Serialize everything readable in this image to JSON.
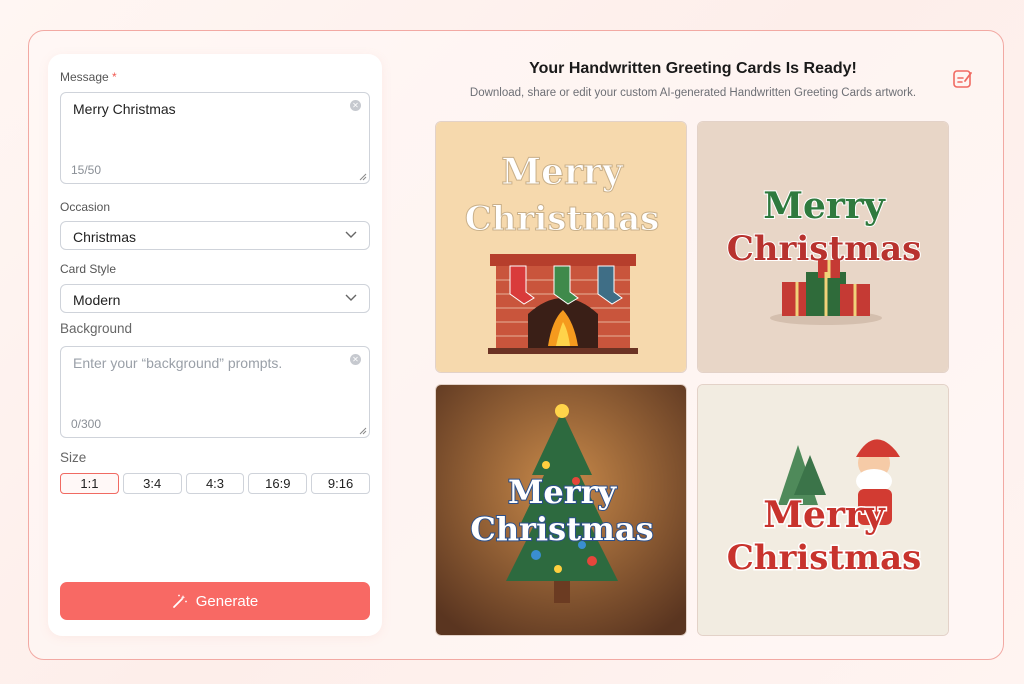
{
  "form": {
    "message": {
      "label": "Message",
      "required_mark": "*",
      "value": "Merry Christmas",
      "count": "15/50"
    },
    "occasion": {
      "label": "Occasion",
      "value": "Christmas"
    },
    "card_style": {
      "label": "Card Style",
      "value": "Modern"
    },
    "background": {
      "label": "Background",
      "placeholder": "Enter your “background” prompts.",
      "count": "0/300"
    },
    "size": {
      "label": "Size",
      "options": [
        "1:1",
        "3:4",
        "4:3",
        "16:9",
        "9:16"
      ],
      "selected": "1:1"
    },
    "generate_label": "Generate"
  },
  "result": {
    "title": "Your Handwritten Greeting Cards Is Ready!",
    "subtitle": "Download, share or edit your custom AI-generated Handwritten Greeting Cards artwork.",
    "cards": [
      {
        "line1": "Merry",
        "line2": "Christmas",
        "theme": "fireplace",
        "bg": "#f6d9ad"
      },
      {
        "line1": "Merry",
        "line2": "Christmas",
        "theme": "gifts",
        "bg": "#e8d6c7"
      },
      {
        "line1": "Merry",
        "line2": "Christmas",
        "theme": "tree",
        "bg": "#8a5a35"
      },
      {
        "line1": "Merry",
        "line2": "Christmas",
        "theme": "santa",
        "bg": "#f2ece1"
      }
    ]
  },
  "colors": {
    "accent": "#f86964",
    "border": "#f2a9a3"
  },
  "icons": {
    "edit": "edit-note-icon",
    "generate": "magic-wand-icon",
    "clear": "clear-circle-icon",
    "dropdown": "chevron-down-icon"
  }
}
